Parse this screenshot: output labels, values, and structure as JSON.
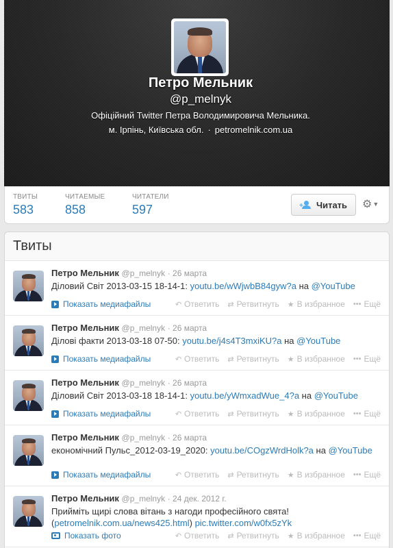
{
  "profile": {
    "name": "Петро Мельник",
    "handle": "@p_melnyk",
    "bio": "Офіційний Twitter Петра Володимировича Мельника.",
    "location": "м. Ірпінь, Київська обл.",
    "separator": "·",
    "website": "petromelnik.com.ua"
  },
  "stats": [
    {
      "label": "ТВИТЫ",
      "value": "583"
    },
    {
      "label": "ЧИТАЕМЫЕ",
      "value": "858"
    },
    {
      "label": "ЧИТАТЕЛИ",
      "value": "597"
    }
  ],
  "follow_button": "Читать",
  "tweets_title": "Твиты",
  "actions": {
    "reply": "Ответить",
    "retweet": "Ретвитнуть",
    "favorite": "В избранное",
    "more": "Ещё"
  },
  "tweets": [
    {
      "name": "Петро Мельник",
      "handle": "@p_melnyk",
      "date": "· 26 марта",
      "text": "Діловий Світ 2013-03-15 18-14-1: ",
      "link": "youtu.be/wWjwbB84gyw?a",
      "mid": " на ",
      "link2": "@YouTube",
      "media": "Показать медиафайлы"
    },
    {
      "name": "Петро Мельник",
      "handle": "@p_melnyk",
      "date": "· 26 марта",
      "text": "Ділові факти 2013-03-18 07-50: ",
      "link": "youtu.be/j4s4T3mxiKU?a",
      "mid": " на ",
      "link2": "@YouTube",
      "media": "Показать медиафайлы"
    },
    {
      "name": "Петро Мельник",
      "handle": "@p_melnyk",
      "date": "· 26 марта",
      "text": "Діловий Світ 2013-03-18 18-14-1: ",
      "link": "youtu.be/yWmxadWue_4?a",
      "mid": " на ",
      "link2": "@YouTube",
      "media": "Показать медиафайлы"
    },
    {
      "name": "Петро Мельник",
      "handle": "@p_melnyk",
      "date": "· 26 марта",
      "text": "економічний Пульс_2012-03-19_2020: ",
      "link": "youtu.be/COgzWrdHolk?a",
      "mid": " на ",
      "link2": "@YouTube",
      "media": "Показать медиафайлы"
    },
    {
      "name": "Петро Мельник",
      "handle": "@p_melnyk",
      "date": "· 24 дек. 2012 г.",
      "text": "Прийміть щирі слова вітань з нагоди професійного свята! (",
      "link": "petromelnik.com.ua/news425.html",
      "mid": ") ",
      "link2": "pic.twitter.com/w0fx5zYk",
      "media": "Показать фото"
    }
  ]
}
